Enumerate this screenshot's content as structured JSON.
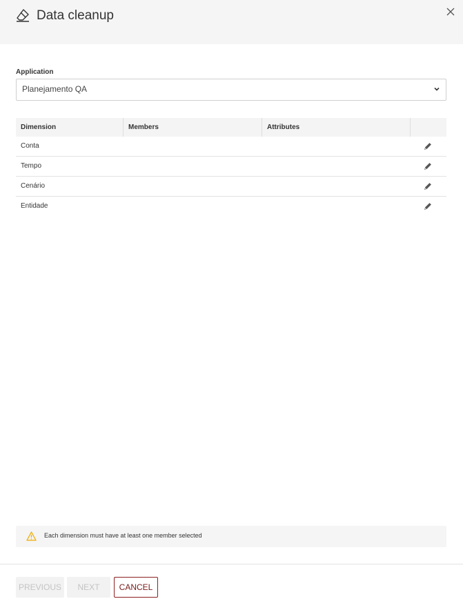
{
  "dialog": {
    "title": "Data cleanup",
    "close_icon": "close-icon",
    "title_icon": "eraser-icon"
  },
  "application": {
    "label": "Application",
    "selected_value": "Planejamento QA"
  },
  "table": {
    "columns": [
      "Dimension",
      "Members",
      "Attributes",
      ""
    ],
    "rows": [
      {
        "dimension": "Conta",
        "members": "",
        "attributes": ""
      },
      {
        "dimension": "Tempo",
        "members": "",
        "attributes": ""
      },
      {
        "dimension": "Cenário",
        "members": "",
        "attributes": ""
      },
      {
        "dimension": "Entidade",
        "members": "",
        "attributes": ""
      }
    ]
  },
  "warning": {
    "text": "Each dimension must have at least one member selected",
    "icon": "warning-icon",
    "icon_color": "#f0ad00"
  },
  "footer": {
    "previous_label": "PREVIOUS",
    "next_label": "NEXT",
    "cancel_label": "CANCEL"
  },
  "colors": {
    "accent": "#8b1e1e",
    "header_bg": "#f5f5f5"
  }
}
